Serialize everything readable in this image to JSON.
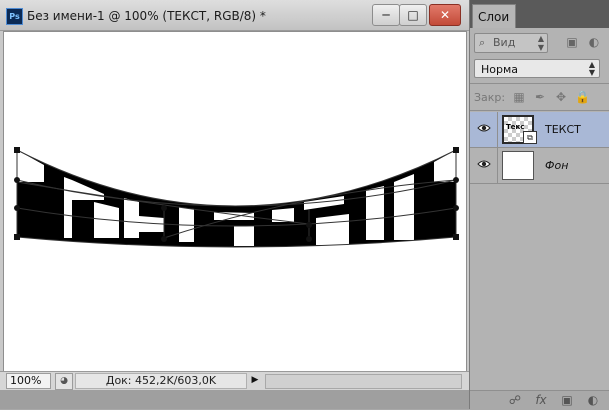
{
  "document": {
    "app_icon": "Ps",
    "title": "Без имени-1 @ 100% (ТЕКСТ, RGB/8) *",
    "window_buttons": {
      "minimize": "minimize-icon",
      "maximize": "maximize-icon",
      "close": "close-icon"
    },
    "canvas": {
      "warped_text": "ТЕКСТ",
      "text_color": "#000000",
      "background": "#ffffff"
    },
    "status": {
      "zoom": "100%",
      "doc_info": "Док: 452,2K/603,0K"
    }
  },
  "layers_panel": {
    "tab_label": "Слои",
    "filter": {
      "label": "Вид",
      "icon": "search-icon"
    },
    "filter_icons": [
      "image-filter-icon",
      "adjustment-filter-icon",
      "text-filter-icon",
      "shape-filter-icon",
      "smart-filter-icon"
    ],
    "blend_mode": "Норма",
    "lock_label": "Закр:",
    "lock_icons": [
      "lock-transparent-icon",
      "lock-brush-icon",
      "lock-move-icon",
      "lock-all-icon"
    ],
    "layers": [
      {
        "name": "ТЕКСТ",
        "visible": true,
        "selected": true,
        "thumb_text": "Текс",
        "smart_object": true
      },
      {
        "name": "Фон",
        "visible": true,
        "selected": false
      }
    ],
    "footer_icons": [
      "link-icon",
      "fx-icon",
      "mask-icon",
      "adjustment-icon"
    ],
    "colors": {
      "selection": "#a9b8d6",
      "panel_bg": "#b3b3b3"
    }
  }
}
